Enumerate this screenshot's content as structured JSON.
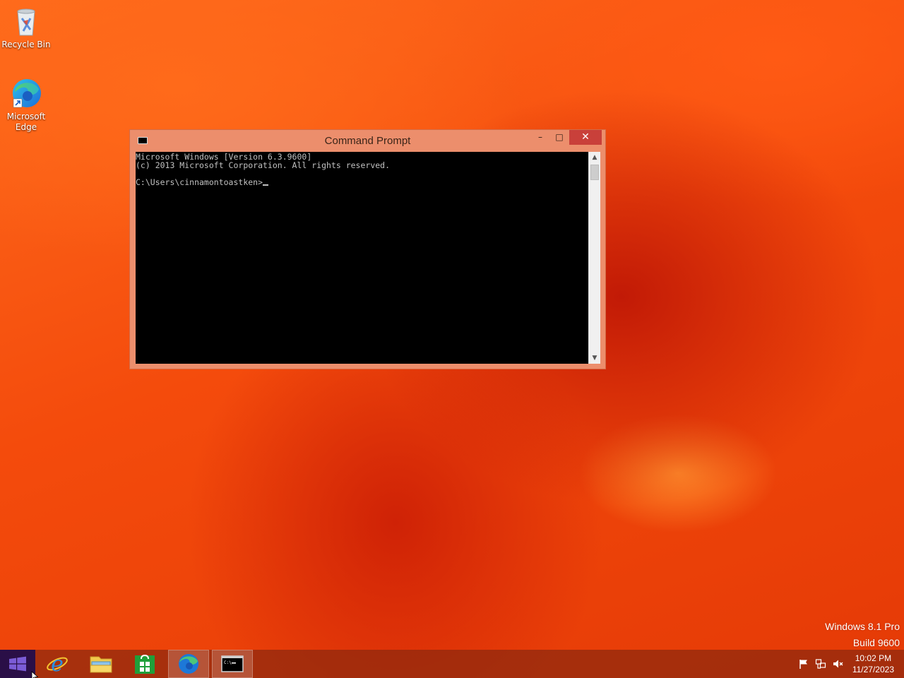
{
  "desktop": {
    "icons": [
      {
        "label": "Recycle Bin"
      },
      {
        "label": "Microsoft Edge"
      }
    ]
  },
  "cmd": {
    "title": "Command Prompt",
    "icon_text": "C:\\",
    "minimize_glyph": "–",
    "maximize_glyph": "□",
    "close_glyph": "✕",
    "lines": [
      "Microsoft Windows [Version 6.3.9600]",
      "(c) 2013 Microsoft Corporation. All rights reserved.",
      "",
      "C:\\Users\\cinnamontoastken>"
    ],
    "colors": {
      "background": "#000000",
      "text": "#c0c0c0",
      "frame": "#ec8e6c",
      "close": "#c9403a"
    }
  },
  "watermark": {
    "line1": "Windows 8.1 Pro",
    "line2": "Build 9600"
  },
  "taskbar": {
    "items": [
      {
        "name": "start-button",
        "icon": "windows-logo-icon"
      },
      {
        "name": "internet-explorer",
        "icon": "internet-explorer-icon"
      },
      {
        "name": "file-explorer",
        "icon": "folder-icon"
      },
      {
        "name": "store",
        "icon": "store-icon"
      },
      {
        "name": "microsoft-edge",
        "icon": "edge-icon"
      },
      {
        "name": "command-prompt",
        "icon": "cmd-icon"
      }
    ],
    "clock": {
      "time": "10:02 PM",
      "date": "11/27/2023"
    }
  }
}
